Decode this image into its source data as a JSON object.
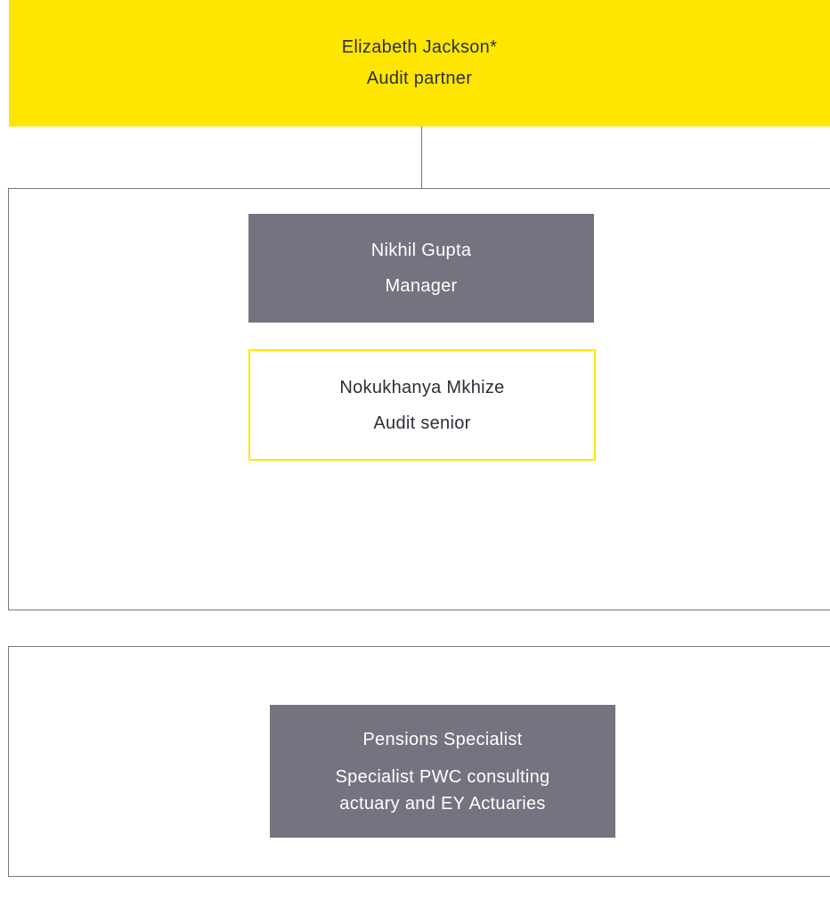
{
  "partner": {
    "name": "Elizabeth Jackson*",
    "role": "Audit partner"
  },
  "core_team": {
    "manager": {
      "name": "Nikhil Gupta",
      "role": "Manager"
    },
    "senior": {
      "name": "Nokukhanya Mkhize",
      "role": "Audit senior"
    }
  },
  "specialists": {
    "pensions": {
      "name": "Pensions Specialist",
      "description": "Specialist PWC consulting\nactuary and EY Actuaries"
    }
  },
  "colors": {
    "partner_fill": "#ffe600",
    "grey_fill": "#747480",
    "outline_border": "#ffe600",
    "panel_border": "#747480",
    "text_dark": "#2e2e38"
  }
}
